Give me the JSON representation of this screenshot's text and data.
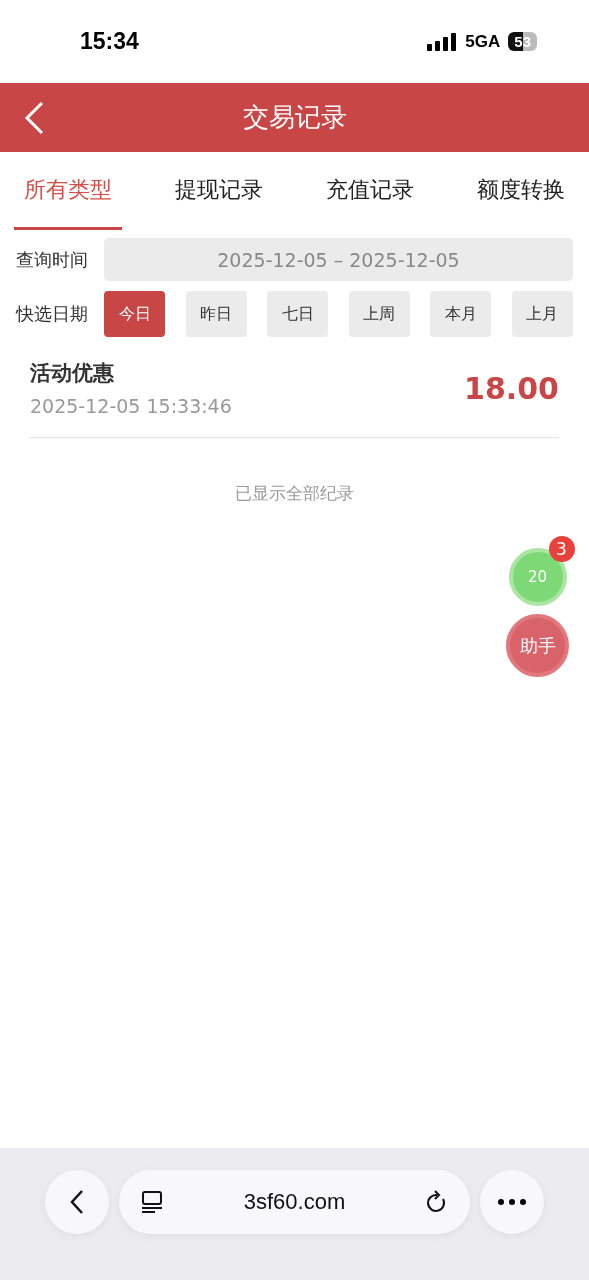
{
  "status_bar": {
    "time": "15:34",
    "network": "5GA",
    "battery": "53"
  },
  "header": {
    "title": "交易记录"
  },
  "tabs": [
    {
      "label": "所有类型",
      "selected": true
    },
    {
      "label": "提现记录",
      "selected": false
    },
    {
      "label": "充值记录",
      "selected": false
    },
    {
      "label": "额度转换",
      "selected": false
    }
  ],
  "query": {
    "label": "查询时间",
    "value": "2025-12-05 – 2025-12-05"
  },
  "quick": {
    "label": "快选日期",
    "options": [
      {
        "label": "今日",
        "selected": true
      },
      {
        "label": "昨日",
        "selected": false
      },
      {
        "label": "七日",
        "selected": false
      },
      {
        "label": "上周",
        "selected": false
      },
      {
        "label": "本月",
        "selected": false
      },
      {
        "label": "上月",
        "selected": false
      }
    ]
  },
  "records": [
    {
      "title": "活动优惠",
      "time": "2025-12-05 15:33:46",
      "amount": "18.00"
    }
  ],
  "end_note": "已显示全部纪录",
  "floats": {
    "count": "20",
    "badge": "3",
    "helper": "助手"
  },
  "browser": {
    "url": "3sf60.com"
  }
}
